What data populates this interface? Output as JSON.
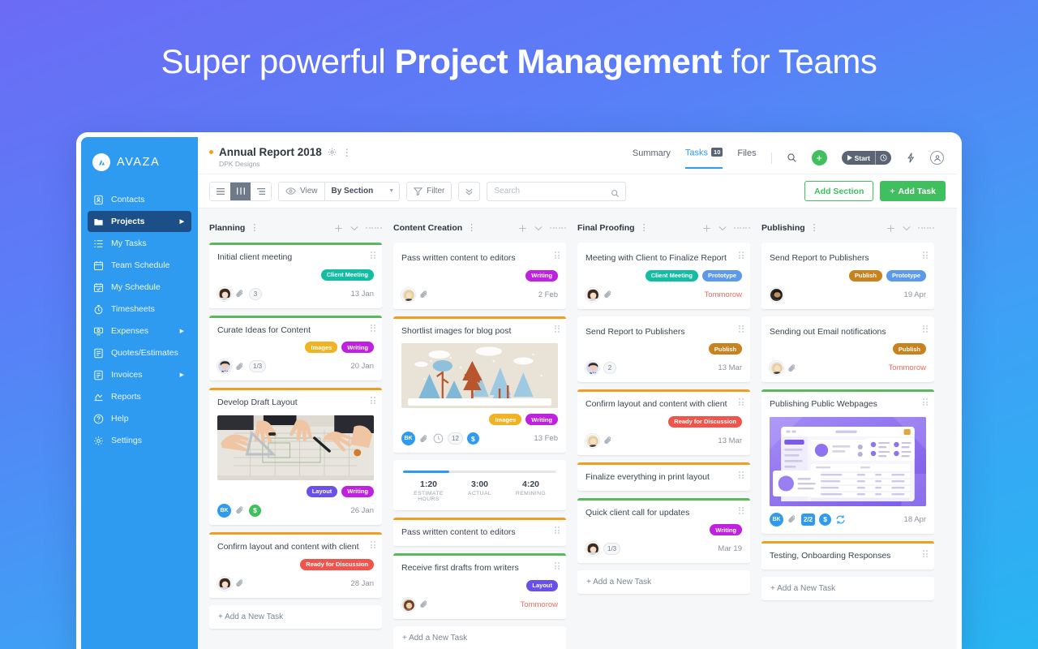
{
  "hero": {
    "prefix": "Super powerful ",
    "bold": "Project Management",
    "suffix": " for Teams"
  },
  "colors": {
    "brand_blue": "#2f9bf0",
    "sidebar_active": "#1c4f87",
    "green": "#3fbf5e",
    "orange_accent": "#f0a020",
    "red": "#f0695f"
  },
  "sidebar": {
    "brand": "AVAZA",
    "items": [
      {
        "label": "Contacts",
        "icon": "contacts-icon",
        "caret": false,
        "active": false
      },
      {
        "label": "Projects",
        "icon": "folder-icon",
        "caret": true,
        "active": true
      },
      {
        "label": "My Tasks",
        "icon": "tasks-icon",
        "caret": false,
        "active": false
      },
      {
        "label": "Team Schedule",
        "icon": "calendar-icon",
        "caret": false,
        "active": false
      },
      {
        "label": "My Schedule",
        "icon": "calendar-check-icon",
        "caret": false,
        "active": false
      },
      {
        "label": "Timesheets",
        "icon": "stopwatch-icon",
        "caret": false,
        "active": false
      },
      {
        "label": "Expenses",
        "icon": "expense-icon",
        "caret": true,
        "active": false
      },
      {
        "label": "Quotes/Estimates",
        "icon": "quote-icon",
        "caret": false,
        "active": false
      },
      {
        "label": "Invoices",
        "icon": "invoice-icon",
        "caret": true,
        "active": false
      },
      {
        "label": "Reports",
        "icon": "reports-icon",
        "caret": false,
        "active": false
      },
      {
        "label": "Help",
        "icon": "help-icon",
        "caret": false,
        "active": false
      },
      {
        "label": "Settings",
        "icon": "gear-icon",
        "caret": false,
        "active": false
      }
    ]
  },
  "project_header": {
    "title": "Annual Report 2018",
    "subtitle": "DPK Designs",
    "nav": [
      {
        "label": "Summary",
        "badge": "",
        "active": false
      },
      {
        "label": "Tasks",
        "badge": "10",
        "active": true
      },
      {
        "label": "Files",
        "badge": "",
        "active": false
      }
    ],
    "start_label": "Start"
  },
  "toolbar": {
    "view_label": "View",
    "group_by": "By Section",
    "filter_label": "Filter",
    "search_placeholder": "Search",
    "search_value": "",
    "add_section_label": "Add Section",
    "add_task_label": "Add Task"
  },
  "board": {
    "add_task_label": "+ Add a New Task",
    "columns": [
      {
        "title": "Planning",
        "cards": [
          {
            "title": "Initial client meeting",
            "accent": "green",
            "tags": [
              {
                "label": "Client Meeting",
                "color": "#13bda4"
              }
            ],
            "avatar": "woman-dark-hair",
            "attachment": true,
            "chip": "3",
            "date": "13 Jan",
            "date_urgent": false,
            "thumb": ""
          },
          {
            "title": "Curate Ideas for Content",
            "accent": "green",
            "tags": [
              {
                "label": "Images",
                "color": "#f0b323"
              },
              {
                "label": "Writing",
                "color": "#c020e0"
              }
            ],
            "avatar": "man-suit",
            "attachment": true,
            "chip": "1/3",
            "date": "20 Jan",
            "date_urgent": false,
            "thumb": ""
          },
          {
            "title": "Develop Draft Layout",
            "accent": "orange",
            "tags": [
              {
                "label": "Layout",
                "color": "#6a4fe8"
              },
              {
                "label": "Writing",
                "color": "#c020e0"
              }
            ],
            "avatar": "",
            "bk": "BK",
            "attachment": true,
            "dollar": "green",
            "date": "26 Jan",
            "date_urgent": false,
            "thumb": "meeting-blueprint-photo"
          },
          {
            "title": "Confirm layout and content with client",
            "accent": "orange",
            "tags": [
              {
                "label": "Ready for Discussion",
                "color": "#f0554b"
              }
            ],
            "avatar": "woman-dark-hair",
            "attachment": true,
            "date": "28 Jan",
            "date_urgent": false,
            "thumb": ""
          }
        ]
      },
      {
        "title": "Content Creation",
        "cards": [
          {
            "title": "Pass written content to editors",
            "accent": "none",
            "tags": [
              {
                "label": "Writing",
                "color": "#c020e0"
              }
            ],
            "avatar": "woman-blonde",
            "attachment": true,
            "date": "2 Feb",
            "date_urgent": false,
            "thumb": ""
          },
          {
            "title": "Shortlist images for blog post",
            "accent": "orange",
            "tags": [
              {
                "label": "Images",
                "color": "#f0b323"
              },
              {
                "label": "Writing",
                "color": "#c020e0"
              }
            ],
            "bk": "BK",
            "attachment": true,
            "clock": true,
            "chip": "12",
            "dollar": "blue",
            "date": "13 Feb",
            "date_urgent": false,
            "thumb": "forest-illustration",
            "time_widget": {
              "progress_pct": 30,
              "stats": [
                {
                  "value": "1:20",
                  "label": "ESTIMATE HOURS"
                },
                {
                  "value": "3:00",
                  "label": "ACTUAL"
                },
                {
                  "value": "4:20",
                  "label": "REMINING"
                }
              ]
            }
          },
          {
            "title": "Pass written content to editors",
            "accent": "orange",
            "tags": [],
            "date": "",
            "thumb": ""
          },
          {
            "title": "Receive first drafts from writers",
            "accent": "green",
            "tags": [
              {
                "label": "Layout",
                "color": "#6a4fe8"
              }
            ],
            "avatar": "woman-brown-hair",
            "attachment": true,
            "date": "Tommorow",
            "date_urgent": true,
            "thumb": ""
          }
        ]
      },
      {
        "title": "Final Proofing",
        "cards": [
          {
            "title": "Meeting with Client to Finalize Report",
            "accent": "none",
            "tags": [
              {
                "label": "Client Meeting",
                "color": "#13bda4"
              },
              {
                "label": "Prototype",
                "color": "#5a9ae8"
              }
            ],
            "avatar": "woman-dark-hair",
            "attachment": true,
            "date": "Tommorow",
            "date_urgent": true,
            "thumb": ""
          },
          {
            "title": "Send Report to Publishers",
            "accent": "none",
            "tags": [
              {
                "label": "Publish",
                "color": "#c8821e"
              }
            ],
            "avatar": "man-suit",
            "chip": "2",
            "date": "13 Mar",
            "date_urgent": false,
            "thumb": ""
          },
          {
            "title": "Confirm layout and content with client",
            "accent": "orange",
            "tags": [
              {
                "label": "Ready for Discussion",
                "color": "#f0554b"
              }
            ],
            "avatar": "woman-blonde",
            "attachment": true,
            "date": "13 Mar",
            "date_urgent": false,
            "thumb": ""
          },
          {
            "title": "Finalize everything in print layout",
            "accent": "orange",
            "tags": [],
            "date": "",
            "thumb": ""
          },
          {
            "title": "Quick client call for updates",
            "accent": "green",
            "tags": [
              {
                "label": "Writing",
                "color": "#c020e0"
              }
            ],
            "avatar": "woman-dark-hair",
            "chip": "1/3",
            "date": "Mar 19",
            "date_urgent": false,
            "thumb": ""
          }
        ]
      },
      {
        "title": "Publishing",
        "cards": [
          {
            "title": "Send Report to Publishers",
            "accent": "none",
            "tags": [
              {
                "label": "Publish",
                "color": "#c8821e"
              },
              {
                "label": "Prototype",
                "color": "#5a9ae8"
              }
            ],
            "avatar": "man-beard",
            "date": "19 Apr",
            "date_urgent": false,
            "thumb": ""
          },
          {
            "title": "Sending out Email notifications",
            "accent": "none",
            "tags": [
              {
                "label": "Publish",
                "color": "#c8821e"
              }
            ],
            "avatar": "woman-blonde",
            "attachment": true,
            "date": "Tommorow",
            "date_urgent": true,
            "thumb": ""
          },
          {
            "title": "Publishing Public Webpages",
            "accent": "green",
            "tags": [],
            "bk": "BK",
            "attachment": true,
            "chip_blue": "2/2",
            "dollar": "blue",
            "repeat": true,
            "date": "18 Apr",
            "date_urgent": false,
            "thumb": "dashboard-mockup"
          },
          {
            "title": "Testing, Onboarding Responses",
            "accent": "orange",
            "tags": [],
            "date": "",
            "thumb": ""
          }
        ]
      }
    ]
  }
}
